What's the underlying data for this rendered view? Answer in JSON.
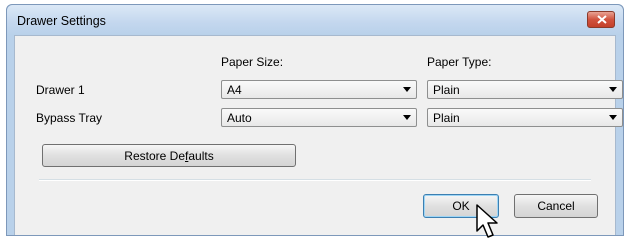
{
  "window": {
    "title": "Drawer Settings"
  },
  "columns": {
    "paper_size": "Paper Size:",
    "paper_type": "Paper Type:"
  },
  "rows": [
    {
      "label": "Drawer 1",
      "paper_size": "A4",
      "paper_type": "Plain"
    },
    {
      "label": "Bypass Tray",
      "paper_size": "Auto",
      "paper_type": "Plain"
    }
  ],
  "buttons": {
    "restore_prefix": "Restore De",
    "restore_mnemonic": "f",
    "restore_suffix": "aults",
    "ok": "OK",
    "cancel": "Cancel"
  },
  "icons": {
    "close": "close-icon",
    "dropdown": "chevron-down-icon",
    "cursor": "mouse-pointer-icon"
  },
  "colors": {
    "title_bar": "#b9d1ea",
    "close_button": "#d1533e",
    "client_bg": "#f0f0f0"
  }
}
